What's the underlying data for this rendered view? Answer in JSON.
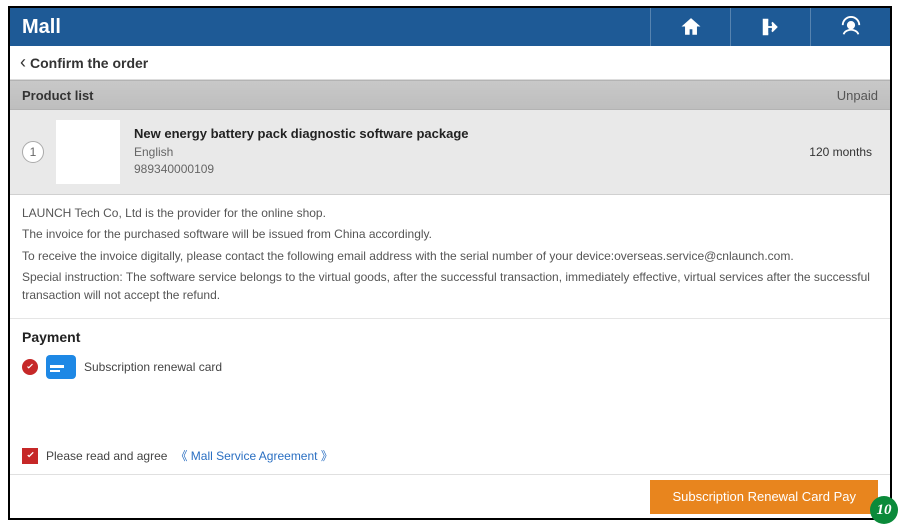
{
  "header": {
    "title": "Mall"
  },
  "subheader": {
    "title": "Confirm the order"
  },
  "product_list": {
    "label": "Product list",
    "status": "Unpaid",
    "items": [
      {
        "index": "1",
        "name": "New energy battery pack diagnostic software package",
        "language": "English",
        "serial": "989340000109",
        "duration": "120 months"
      }
    ]
  },
  "notes": {
    "line1": "LAUNCH Tech Co, Ltd is the provider for the online shop.",
    "line2": "The invoice for the purchased software will be issued from China accordingly.",
    "line3": "To receive the invoice digitally, please contact the following email address with the serial number of your device:overseas.service@cnlaunch.com.",
    "line4": "Special instruction: The software service belongs to the virtual goods, after the successful transaction, immediately effective, virtual services after the successful transaction will not accept the refund."
  },
  "payment": {
    "title": "Payment",
    "option1_label": "Subscription renewal card"
  },
  "agreement": {
    "lead": "Please read and agree",
    "link": "《 Mall Service Agreement 》"
  },
  "footer": {
    "pay_label": "Subscription Renewal Card Pay"
  },
  "step_badge": "10"
}
